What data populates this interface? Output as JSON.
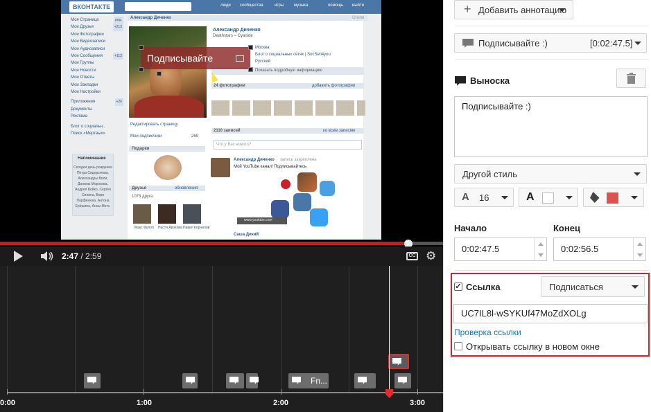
{
  "video": {
    "vk": {
      "logo": "ВКОНТАКТЕ",
      "nav": [
        "люди",
        "сообщества",
        "игры",
        "музыка",
        "помощь",
        "выйти"
      ],
      "side_menu": [
        {
          "label": "Моя Страница",
          "count": "ред."
        },
        {
          "label": "Мои Друзья",
          "count": "+213"
        },
        {
          "label": "Мои Фотографии",
          "count": ""
        },
        {
          "label": "Мои Видеозаписи",
          "count": ""
        },
        {
          "label": "Мои Аудиозаписи",
          "count": ""
        },
        {
          "label": "Мои Сообщения",
          "count": "+112"
        },
        {
          "label": "Мои Группы",
          "count": ""
        },
        {
          "label": "Мои Новости",
          "count": ""
        },
        {
          "label": "Мои Ответы",
          "count": ""
        },
        {
          "label": "Мои Закладки",
          "count": ""
        },
        {
          "label": "Мои Настройки",
          "count": ""
        },
        {
          "label": "Приложения",
          "count": "+26"
        },
        {
          "label": "Документы",
          "count": ""
        },
        {
          "label": "Реклама",
          "count": ""
        },
        {
          "label": "Блог о социальн..",
          "count": ""
        },
        {
          "label": "Поиск «Мертвых»",
          "count": ""
        }
      ],
      "page_header": "Александр Диченко",
      "online": "Online",
      "profile_name": "Александр Диченко",
      "status": "Deathstars – Cyanide",
      "city": "Москва",
      "link": "Блог о социальных сетях | SocSeti4you",
      "lang": "Русский",
      "more_info": "Показать подробную информацию",
      "photos": "24 фотографии",
      "add_photos": "добавить фотографии",
      "edit_page": "Редактировать страницу",
      "subscribers": "Мои подписчики",
      "sub_count": "269",
      "gifts": "Подарки",
      "friends": "Друзья",
      "friends_update": "обновления",
      "friends_count": "1073 друга",
      "friend_names": [
        "Макс Фулоп",
        "Настя Арохова",
        "Павел Корнилов"
      ],
      "posts": "2110 записей",
      "my_posts": "ко всем записям",
      "whats_new": "Что у Вас нового?",
      "post_author": "Александр Диченко",
      "post_pinned": "запись закреплена",
      "post_text": "Мой YouTube канал! Подписывайтесь",
      "post_url": "www.youtube.com",
      "next_author": "Саша Дикий",
      "reminder": "Напоминание",
      "reminder_text": "Сегодня день рождения Петра Сидорычева, Александры Воли, Данилы Морозова, Андрея Бойко, Сергея Силина, Вори Парфенюка, Антона Ерёшина, Анны Метс."
    },
    "annotation_text": "Подписывайте"
  },
  "player": {
    "current_time": "2:47",
    "duration": "/ 2:59",
    "cc_label": "CC",
    "progress_fraction": 0.93
  },
  "timeline": {
    "labels": [
      "0:00",
      "1:00",
      "2:00",
      "3:00"
    ],
    "marker_text": "Fn..."
  },
  "panel": {
    "add_annotation": "Добавить аннотацию",
    "current_annotation": "Подписывайте :)",
    "current_annotation_time": "[0:02:47.5]",
    "type_label": "Выноска",
    "text_value": "Подписывайте :)",
    "style_select": "Другой стиль",
    "font_size": "16",
    "start_label": "Начало",
    "end_label": "Конец",
    "start_value": "0:02:47.5",
    "end_value": "0:02:56.5",
    "link_label": "Ссылка",
    "link_type": "Подписаться",
    "link_value": "UC7IL8l-wSYKUf47MoZdXOLg",
    "check_link": "Проверка ссылки",
    "new_window": "Открывать ссылку в новом окне",
    "bg_color": "#d9534f",
    "text_color": "#ffffff",
    "link_checked": true,
    "new_window_checked": false
  },
  "colors": {
    "accent_red": "#cc181e",
    "highlight_border": "#d9232b",
    "vk_blue": "#4a76a8",
    "link_blue": "#167ac6"
  }
}
